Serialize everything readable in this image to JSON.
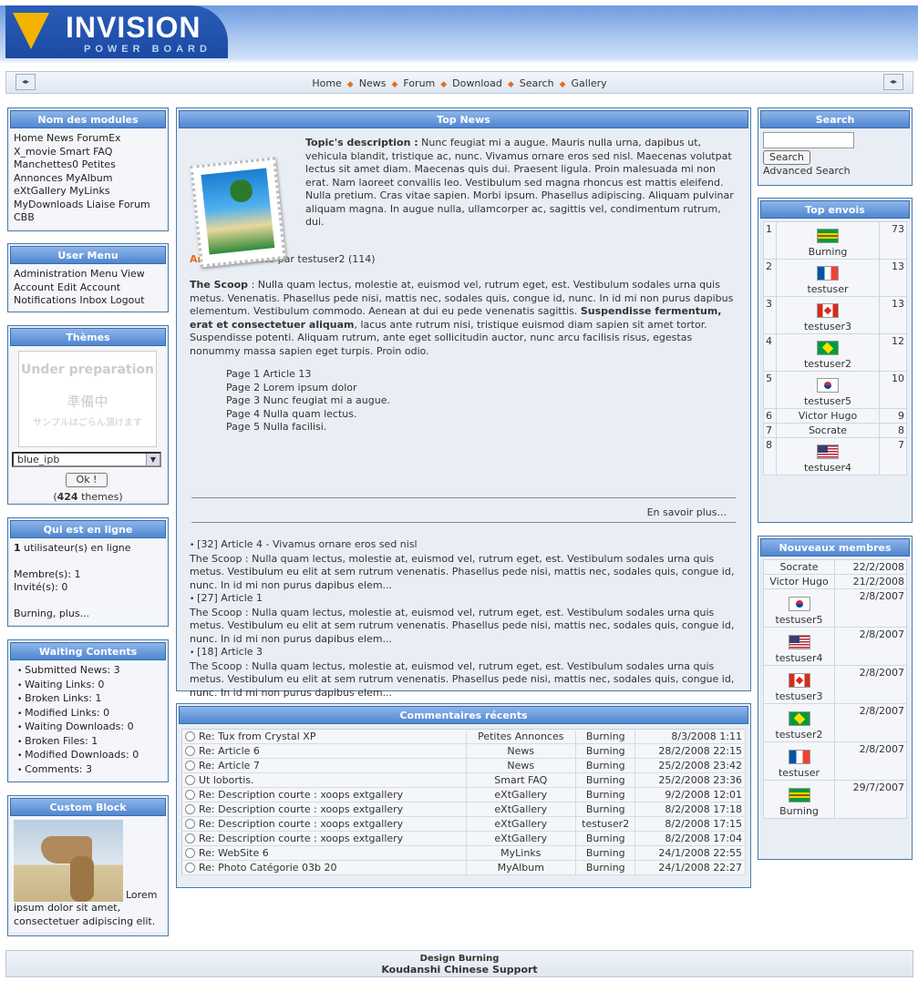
{
  "header": {
    "logo_main": "INVISION",
    "logo_sub": "POWER BOARD"
  },
  "nav": {
    "links": [
      "Home",
      "News",
      "Forum",
      "Download",
      "Search",
      "Gallery"
    ]
  },
  "modules": {
    "title": "Nom des modules",
    "text": "Home News ForumEx X_movie Smart FAQ Manchettes0 Petites Annonces MyAlbum eXtGallery MyLinks MyDownloads Liaise Forum CBB"
  },
  "usermenu": {
    "title": "User Menu",
    "text": "Administration Menu View Account Edit Account Notifications Inbox Logout"
  },
  "themes": {
    "title": "Thèmes",
    "preview_text1": "Under preparation",
    "preview_text2": "準備中",
    "preview_text3": "サンプルはごらん頂けます",
    "selected": "blue_ipb",
    "ok_label": "Ok !",
    "count": "424",
    "count_suffix": "themes)"
  },
  "online": {
    "title": "Qui est en ligne",
    "count": "1",
    "count_text": "utilisateur(s) en ligne",
    "members": "Membre(s): 1",
    "guests": "Invité(s): 0",
    "names": "Burning, plus..."
  },
  "waiting": {
    "title": "Waiting Contents",
    "items": [
      "Submitted News: 3",
      "Waiting Links: 0",
      "Broken Links: 1",
      "Modified Links: 0",
      "Waiting Downloads: 0",
      "Broken Files: 1",
      "Modified Downloads: 0",
      "Comments: 3"
    ]
  },
  "custom": {
    "title": "Custom Block",
    "text_inline": "Lorem",
    "text": "ipsum dolor sit amet, consectetuer adipiscing elit."
  },
  "topnews": {
    "title": "Top News",
    "desc_label": "Topic's description :",
    "desc": "Nunc feugiat mi a augue. Mauris nulla urna, dapibus ut, vehicula blandit, tristique ac, nunc. Vivamus ornare eros sed nisl. Maecenas volutpat lectus sit amet diam. Maecenas quis dui. Praesent ligula. Proin malesuada mi non erat. Nam laoreet convallis leo. Vestibulum sed magna rhoncus est mattis eleifend. Nulla pretium. Cras vitae sapien. Morbi ipsum. Phasellus adipiscing. Aliquam pulvinar aliquam magna. In augue nulla, ullamcorper ac, sagittis vel, condimentum rutrum, dui.",
    "article_title": "Article 13",
    "article_meta": "Posté par testuser2 (114)",
    "scoop_label": "The Scoop",
    "scoop_text": ": Nulla quam lectus, molestie at, euismod vel, rutrum eget, est. Vestibulum sodales urna quis metus. Venenatis. Phasellus pede nisi, mattis nec, sodales quis, congue id, nunc. In id mi non purus dapibus elementum. Vestibulum commodo. Aenean at dui eu pede venenatis sagittis.",
    "scoop_bold": "Suspendisse fermentum, erat et consectetuer aliquam",
    "scoop_text2": ", lacus ante rutrum nisi, tristique euismod diam sapien sit amet tortor. Suspendisse potenti. Aliquam rutrum, ante eget sollicitudin auctor, nunc arcu facilisis risus, egestas nonummy massa sapien eget turpis. Proin odio.",
    "pages": [
      "Page 1 Article 13",
      "Page 2 Lorem ipsum dolor",
      "Page 3 Nunc feugiat mi a augue.",
      "Page 4 Nulla quam lectus.",
      "Page 5 Nulla facilisi."
    ],
    "more": "En savoir plus...",
    "others": [
      {
        "title": "[32] Article 4 - Vivamus ornare eros sed nisl",
        "text": "The Scoop : Nulla quam lectus, molestie at, euismod vel, rutrum eget, est. Vestibulum sodales urna quis metus. Vestibulum eu elit at sem rutrum venenatis. Phasellus pede nisi, mattis nec, sodales quis, congue id, nunc. In id mi non purus dapibus elem..."
      },
      {
        "title": "[27] Article 1",
        "text": "The Scoop : Nulla quam lectus, molestie at, euismod vel, rutrum eget, est. Vestibulum sodales urna quis metus. Vestibulum eu elit at sem rutrum venenatis. Phasellus pede nisi, mattis nec, sodales quis, congue id, nunc. In id mi non purus dapibus elem..."
      },
      {
        "title": "[18] Article 3",
        "text": "The Scoop : Nulla quam lectus, molestie at, euismod vel, rutrum eget, est. Vestibulum sodales urna quis metus. Vestibulum eu elit at sem rutrum venenatis. Phasellus pede nisi, mattis nec, sodales quis, congue id, nunc. In id mi non purus dapibus elem..."
      }
    ]
  },
  "comments": {
    "title": "Commentaires récents",
    "rows": [
      [
        "Re: Tux from Crystal XP",
        "Petites Annonces",
        "Burning",
        "8/3/2008 1:11"
      ],
      [
        "Re: Article 6",
        "News",
        "Burning",
        "28/2/2008 22:15"
      ],
      [
        "Re: Article 7",
        "News",
        "Burning",
        "25/2/2008 23:42"
      ],
      [
        "Ut lobortis.",
        "Smart FAQ",
        "Burning",
        "25/2/2008 23:36"
      ],
      [
        "Re: Description courte : xoops extgallery",
        "eXtGallery",
        "Burning",
        "9/2/2008 12:01"
      ],
      [
        "Re: Description courte : xoops extgallery",
        "eXtGallery",
        "Burning",
        "8/2/2008 17:18"
      ],
      [
        "Re: Description courte : xoops extgallery",
        "eXtGallery",
        "testuser2",
        "8/2/2008 17:15"
      ],
      [
        "Re: Description courte : xoops extgallery",
        "eXtGallery",
        "Burning",
        "8/2/2008 17:04"
      ],
      [
        "Re: WebSite 6",
        "MyLinks",
        "Burning",
        "24/1/2008 22:55"
      ],
      [
        "Re: Photo Catégorie 03b 20",
        "MyAlbum",
        "Burning",
        "24/1/2008 22:27"
      ]
    ]
  },
  "search": {
    "title": "Search",
    "button": "Search",
    "advanced": "Advanced Search"
  },
  "topposters": {
    "title": "Top envois",
    "rows": [
      {
        "rank": "1",
        "name": "Burning",
        "posts": "73",
        "flag": "f-jm"
      },
      {
        "rank": "2",
        "name": "testuser",
        "posts": "13",
        "flag": "f-fr"
      },
      {
        "rank": "3",
        "name": "testuser3",
        "posts": "13",
        "flag": "f-ca"
      },
      {
        "rank": "4",
        "name": "testuser2",
        "posts": "12",
        "flag": "f-br"
      },
      {
        "rank": "5",
        "name": "testuser5",
        "posts": "10",
        "flag": "f-kr"
      },
      {
        "rank": "6",
        "name": "Victor Hugo",
        "posts": "9",
        "flag": ""
      },
      {
        "rank": "7",
        "name": "Socrate",
        "posts": "8",
        "flag": ""
      },
      {
        "rank": "8",
        "name": "testuser4",
        "posts": "7",
        "flag": "f-us"
      }
    ]
  },
  "newmembers": {
    "title": "Nouveaux membres",
    "rows": [
      {
        "name": "Socrate",
        "date": "22/2/2008",
        "flag": ""
      },
      {
        "name": "Victor Hugo",
        "date": "21/2/2008",
        "flag": ""
      },
      {
        "name": "testuser5",
        "date": "2/8/2007",
        "flag": "f-kr"
      },
      {
        "name": "testuser4",
        "date": "2/8/2007",
        "flag": "f-us"
      },
      {
        "name": "testuser3",
        "date": "2/8/2007",
        "flag": "f-ca"
      },
      {
        "name": "testuser2",
        "date": "2/8/2007",
        "flag": "f-br"
      },
      {
        "name": "testuser",
        "date": "2/8/2007",
        "flag": "f-fr"
      },
      {
        "name": "Burning",
        "date": "29/7/2007",
        "flag": "f-jm"
      }
    ]
  },
  "footer": {
    "line1": "Design Burning",
    "line2": "Koudanshi Chinese Support"
  }
}
